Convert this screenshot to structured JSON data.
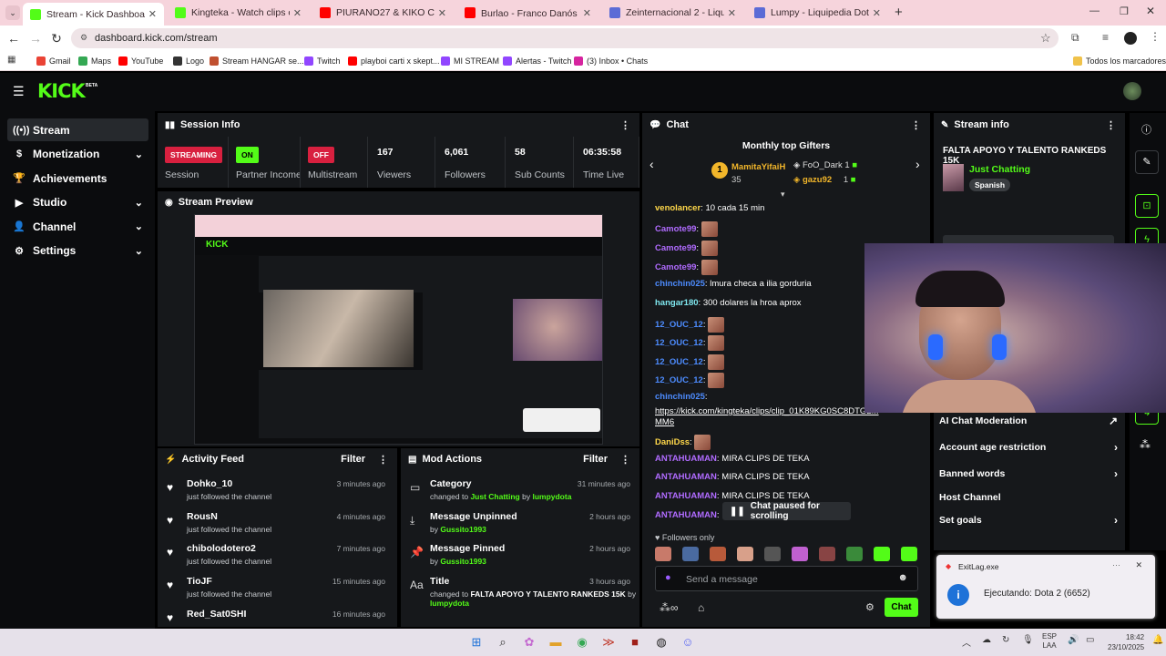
{
  "tabs": [
    {
      "label": "Stream - Kick Dashboard",
      "color": "#53fc18",
      "active": true
    },
    {
      "label": "Kingteka - Watch clips on K",
      "color": "#53fc18"
    },
    {
      "label": "PIURANO27 & KIKO CHOSICA",
      "color": "#ff0000"
    },
    {
      "label": "Burlao - Franco Danós 🧉 @N",
      "color": "#ff0000"
    },
    {
      "label": "Zeinternacional 2 - Liquipedia",
      "color": "#5b6bd6"
    },
    {
      "label": "Lumpy - Liquipedia Dota 2 Wiki",
      "color": "#5b6bd6"
    }
  ],
  "url": "dashboard.kick.com/stream",
  "bookmarks": [
    {
      "label": "Gmail",
      "color": "#ea4335"
    },
    {
      "label": "Maps",
      "color": "#34a853"
    },
    {
      "label": "YouTube",
      "color": "#ff0000"
    },
    {
      "label": "Logo",
      "color": "#333"
    },
    {
      "label": "Stream HANGAR se...",
      "color": "#c05030"
    },
    {
      "label": "Twitch",
      "color": "#9146ff"
    },
    {
      "label": "playboi carti x skept...",
      "color": "#ff0000"
    },
    {
      "label": "MI STREAM",
      "color": "#9146ff"
    },
    {
      "label": "Alertas - Twitch",
      "color": "#9146ff"
    },
    {
      "label": "(3) Inbox • Chats",
      "color": "#d6249f"
    }
  ],
  "bookmarks_all": "Todos los marcadores",
  "logo": "KICK",
  "beta": "BETA",
  "sidebar": [
    {
      "icon": "stream",
      "label": "Stream",
      "chev": ""
    },
    {
      "icon": "monetization",
      "label": "Monetization",
      "chev": "⌄"
    },
    {
      "icon": "trophy",
      "label": "Achievements",
      "chev": ""
    },
    {
      "icon": "studio",
      "label": "Studio",
      "chev": "⌄"
    },
    {
      "icon": "channel",
      "label": "Channel",
      "chev": "⌄"
    },
    {
      "icon": "settings",
      "label": "Settings",
      "chev": "⌄"
    }
  ],
  "session": {
    "title": "Session Info",
    "items": [
      {
        "badge": "STREAMING",
        "label": "Session"
      },
      {
        "badge": "ON",
        "label": "Partner Income"
      },
      {
        "badge": "OFF",
        "label": "Multistream"
      },
      {
        "num": "167",
        "label": "Viewers"
      },
      {
        "num": "6,061",
        "label": "Followers"
      },
      {
        "num": "58",
        "label": "Sub Counts"
      },
      {
        "num": "06:35:58",
        "label": "Time Live"
      }
    ]
  },
  "preview": {
    "title": "Stream Preview"
  },
  "activity": {
    "title": "Activity Feed",
    "filter": "Filter",
    "rows": [
      {
        "name": "Dohko_10",
        "sub": "just followed the channel",
        "time": "3 minutes ago"
      },
      {
        "name": "RousN",
        "sub": "just followed the channel",
        "time": "4 minutes ago"
      },
      {
        "name": "chibolodotero2",
        "sub": "just followed the channel",
        "time": "7 minutes ago"
      },
      {
        "name": "TioJF",
        "sub": "just followed the channel",
        "time": "15 minutes ago"
      },
      {
        "name": "Red_Sat0SHI",
        "sub": "",
        "time": "16 minutes ago"
      }
    ]
  },
  "mod": {
    "title": "Mod Actions",
    "filter": "Filter",
    "rows": [
      {
        "icon": "category",
        "title": "Category",
        "pre": "changed to ",
        "hl": "Just Chatting",
        "mid": " by ",
        "user": "lumpydota",
        "time": "31 minutes ago"
      },
      {
        "icon": "unpin",
        "title": "Message Unpinned",
        "pre": "by ",
        "hl": "",
        "mid": "",
        "user": "Gussito1993",
        "time": "2 hours ago"
      },
      {
        "icon": "pin",
        "title": "Message Pinned",
        "pre": "by ",
        "hl": "",
        "mid": "",
        "user": "Gussito1993",
        "time": "2 hours ago"
      },
      {
        "icon": "title",
        "title": "Title",
        "pre": "changed to ",
        "hl": "FALTA APOYO Y TALENTO RANKEDS 15K",
        "mid": " by ",
        "user": "lumpydota",
        "time": "3 hours ago"
      }
    ]
  },
  "chat": {
    "title": "Chat",
    "gifters_title": "Monthly top Gifters",
    "gifter1": {
      "name": "MamitaYifaiH",
      "count": "35"
    },
    "gifter2": {
      "name": "FoO_Dark",
      "count": "1"
    },
    "gifter3": {
      "name": "gazu92",
      "count": "1"
    },
    "messages": [
      {
        "user": "venolancer",
        "color": "#ffd84a",
        "text": "10 cada 15 min",
        "emote": false
      },
      {
        "user": "Camote99",
        "color": "#b06bff",
        "text": "",
        "emote": true
      },
      {
        "user": "Camote99",
        "color": "#b06bff",
        "text": "",
        "emote": true
      },
      {
        "user": "Camote99",
        "color": "#b06bff",
        "text": "",
        "emote": true
      },
      {
        "user": "chinchin025",
        "color": "#4d8cff",
        "text": "lmura checa a ilia gorduria",
        "emote": false
      },
      {
        "user": "hangar180",
        "color": "#7fe8f0",
        "text": "300 dolares la hroa aprox",
        "emote": false
      },
      {
        "user": "12_OUC_12",
        "color": "#4d8cff",
        "text": "",
        "emote": true
      },
      {
        "user": "12_OUC_12",
        "color": "#4d8cff",
        "text": "",
        "emote": true
      },
      {
        "user": "12_OUC_12",
        "color": "#4d8cff",
        "text": "",
        "emote": true
      },
      {
        "user": "12_OUC_12",
        "color": "#4d8cff",
        "text": "",
        "emote": true
      },
      {
        "user": "chinchin025",
        "color": "#4d8cff",
        "text": "",
        "emote": false
      },
      {
        "user": "DaniDss",
        "color": "#ffd84a",
        "text": "",
        "emote": true
      },
      {
        "user": "ANTAHUAMAN",
        "color": "#b06bff",
        "text": "MIRA CLIPS DE TEKA",
        "emote": false
      },
      {
        "user": "ANTAHUAMAN",
        "color": "#b06bff",
        "text": "MIRA CLIPS DE TEKA",
        "emote": false
      },
      {
        "user": "ANTAHUAMAN",
        "color": "#b06bff",
        "text": "MIRA CLIPS DE TEKA",
        "emote": false
      },
      {
        "user": "ANTAHUAMAN",
        "color": "#b06bff",
        "text": "M",
        "emote": false
      }
    ],
    "link": "https://kick.com/kingteka/clips/clip_01K89KG0SC8DTG2...",
    "link2": "MM6",
    "paused": "Chat paused for scrolling",
    "followers_only": "Followers only",
    "placeholder": "Send a message",
    "send": "Chat"
  },
  "streaminfo": {
    "title": "Stream info",
    "stream_title": "FALTA APOYO Y TALENTO RANKEDS 15K",
    "category": "Just Chatting",
    "language": "Spanish",
    "rows": [
      {
        "label": "AI Chat Moderation",
        "chev": "↗"
      },
      {
        "label": "Account age restriction",
        "chev": "›"
      },
      {
        "label": "Banned words",
        "chev": "›"
      },
      {
        "label": "Host Channel",
        "chev": ""
      },
      {
        "label": "Set goals",
        "chev": "›"
      }
    ]
  },
  "notification": {
    "app": "ExitLag.exe",
    "text": "Ejecutando: Dota 2 (6652)"
  },
  "tray": {
    "lang1": "ESP",
    "lang2": "LAA",
    "time": "18:42",
    "date": "23/10/2025"
  }
}
